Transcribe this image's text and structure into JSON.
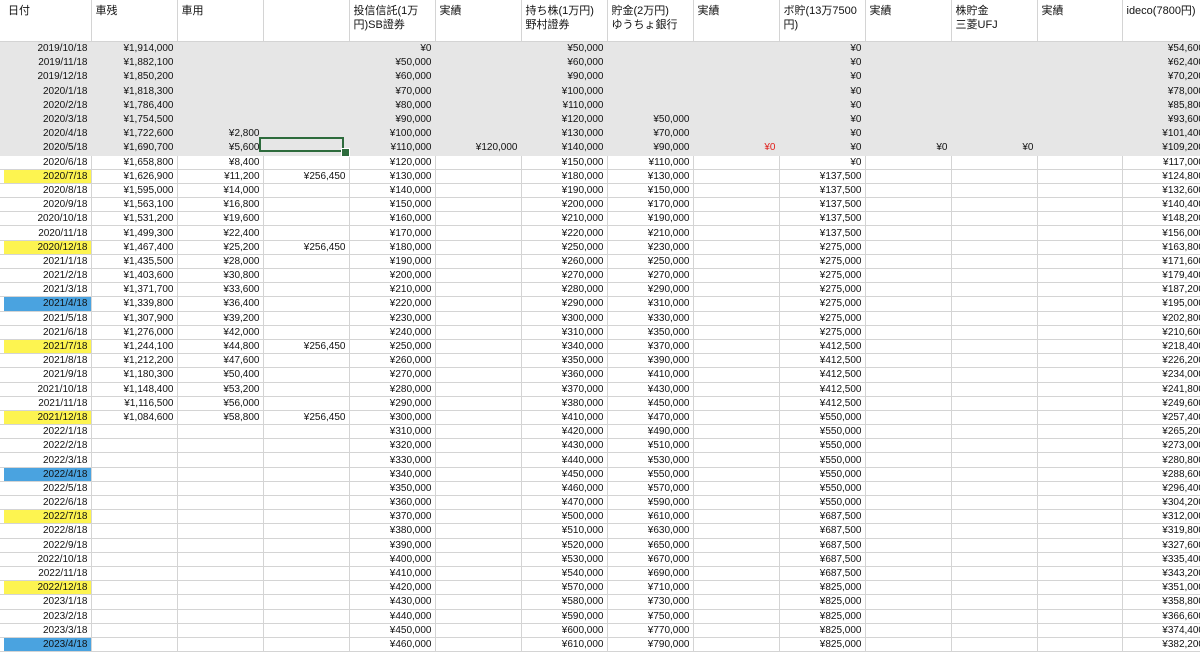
{
  "headers": [
    "日付",
    "車残",
    "車用",
    "",
    "投信信託(1万\n円)SB證券",
    "実績",
    "持ち株(1万円)\n野村證券",
    "貯金(2万円)\nゆうちょ銀行",
    "実績",
    "ボ貯(13万7500\n円)",
    "実績",
    "株貯金\n三菱UFJ",
    "実績",
    "ideco(7800円)"
  ],
  "rows": [
    {
      "date": "2019/10/18",
      "car_balance": "¥1,914,000",
      "car_use": "",
      "col4": "",
      "trust": "¥0",
      "trust_actual": "",
      "stock": "¥50,000",
      "savings": "",
      "savings_actual": "",
      "bonus": "¥0",
      "bonus_actual": "",
      "kabu": "",
      "kabu_actual": "",
      "ideco": "¥54,600",
      "grey": true
    },
    {
      "date": "2019/11/18",
      "car_balance": "¥1,882,100",
      "car_use": "",
      "col4": "",
      "trust": "¥50,000",
      "trust_actual": "",
      "stock": "¥60,000",
      "savings": "",
      "savings_actual": "",
      "bonus": "¥0",
      "bonus_actual": "",
      "kabu": "",
      "kabu_actual": "",
      "ideco": "¥62,400",
      "grey": true
    },
    {
      "date": "2019/12/18",
      "car_balance": "¥1,850,200",
      "car_use": "",
      "col4": "",
      "trust": "¥60,000",
      "trust_actual": "",
      "stock": "¥90,000",
      "savings": "",
      "savings_actual": "",
      "bonus": "¥0",
      "bonus_actual": "",
      "kabu": "",
      "kabu_actual": "",
      "ideco": "¥70,200",
      "grey": true
    },
    {
      "date": "2020/1/18",
      "car_balance": "¥1,818,300",
      "car_use": "",
      "col4": "",
      "trust": "¥70,000",
      "trust_actual": "",
      "stock": "¥100,000",
      "savings": "",
      "savings_actual": "",
      "bonus": "¥0",
      "bonus_actual": "",
      "kabu": "",
      "kabu_actual": "",
      "ideco": "¥78,000",
      "grey": true
    },
    {
      "date": "2020/2/18",
      "car_balance": "¥1,786,400",
      "car_use": "",
      "col4": "",
      "trust": "¥80,000",
      "trust_actual": "",
      "stock": "¥110,000",
      "savings": "",
      "savings_actual": "",
      "bonus": "¥0",
      "bonus_actual": "",
      "kabu": "",
      "kabu_actual": "",
      "ideco": "¥85,800",
      "grey": true
    },
    {
      "date": "2020/3/18",
      "car_balance": "¥1,754,500",
      "car_use": "",
      "col4": "",
      "trust": "¥90,000",
      "trust_actual": "",
      "stock": "¥120,000",
      "savings": "¥50,000",
      "savings_actual": "",
      "bonus": "¥0",
      "bonus_actual": "",
      "kabu": "",
      "kabu_actual": "",
      "ideco": "¥93,600",
      "grey": true
    },
    {
      "date": "2020/4/18",
      "car_balance": "¥1,722,600",
      "car_use": "¥2,800",
      "col4": "",
      "trust": "¥100,000",
      "trust_actual": "",
      "stock": "¥130,000",
      "savings": "¥70,000",
      "savings_actual": "",
      "bonus": "¥0",
      "bonus_actual": "",
      "kabu": "",
      "kabu_actual": "",
      "ideco": "¥101,400",
      "grey": true
    },
    {
      "date": "2020/5/18",
      "car_balance": "¥1,690,700",
      "car_use": "¥5,600",
      "col4": "",
      "trust": "¥110,000",
      "trust_actual": "¥120,000",
      "stock": "¥140,000",
      "savings": "¥90,000",
      "savings_actual": "¥0",
      "bonus": "¥0",
      "bonus_actual": "¥0",
      "kabu": "¥0",
      "kabu_actual": "",
      "ideco": "¥109,200",
      "grey": true
    },
    {
      "date": "2020/6/18",
      "car_balance": "¥1,658,800",
      "car_use": "¥8,400",
      "col4": "",
      "trust": "¥120,000",
      "trust_actual": "",
      "stock": "¥150,000",
      "savings": "¥110,000",
      "savings_actual": "",
      "bonus": "¥0",
      "bonus_actual": "",
      "kabu": "",
      "kabu_actual": "",
      "ideco": "¥117,000"
    },
    {
      "date": "2020/7/18",
      "car_balance": "¥1,626,900",
      "car_use": "¥11,200",
      "col4": "¥256,450",
      "trust": "¥130,000",
      "trust_actual": "",
      "stock": "¥180,000",
      "savings": "¥130,000",
      "savings_actual": "",
      "bonus": "¥137,500",
      "bonus_actual": "",
      "kabu": "",
      "kabu_actual": "",
      "ideco": "¥124,800",
      "hl": "yellow"
    },
    {
      "date": "2020/8/18",
      "car_balance": "¥1,595,000",
      "car_use": "¥14,000",
      "col4": "",
      "trust": "¥140,000",
      "trust_actual": "",
      "stock": "¥190,000",
      "savings": "¥150,000",
      "savings_actual": "",
      "bonus": "¥137,500",
      "bonus_actual": "",
      "kabu": "",
      "kabu_actual": "",
      "ideco": "¥132,600"
    },
    {
      "date": "2020/9/18",
      "car_balance": "¥1,563,100",
      "car_use": "¥16,800",
      "col4": "",
      "trust": "¥150,000",
      "trust_actual": "",
      "stock": "¥200,000",
      "savings": "¥170,000",
      "savings_actual": "",
      "bonus": "¥137,500",
      "bonus_actual": "",
      "kabu": "",
      "kabu_actual": "",
      "ideco": "¥140,400"
    },
    {
      "date": "2020/10/18",
      "car_balance": "¥1,531,200",
      "car_use": "¥19,600",
      "col4": "",
      "trust": "¥160,000",
      "trust_actual": "",
      "stock": "¥210,000",
      "savings": "¥190,000",
      "savings_actual": "",
      "bonus": "¥137,500",
      "bonus_actual": "",
      "kabu": "",
      "kabu_actual": "",
      "ideco": "¥148,200"
    },
    {
      "date": "2020/11/18",
      "car_balance": "¥1,499,300",
      "car_use": "¥22,400",
      "col4": "",
      "trust": "¥170,000",
      "trust_actual": "",
      "stock": "¥220,000",
      "savings": "¥210,000",
      "savings_actual": "",
      "bonus": "¥137,500",
      "bonus_actual": "",
      "kabu": "",
      "kabu_actual": "",
      "ideco": "¥156,000"
    },
    {
      "date": "2020/12/18",
      "car_balance": "¥1,467,400",
      "car_use": "¥25,200",
      "col4": "¥256,450",
      "trust": "¥180,000",
      "trust_actual": "",
      "stock": "¥250,000",
      "savings": "¥230,000",
      "savings_actual": "",
      "bonus": "¥275,000",
      "bonus_actual": "",
      "kabu": "",
      "kabu_actual": "",
      "ideco": "¥163,800",
      "hl": "yellow"
    },
    {
      "date": "2021/1/18",
      "car_balance": "¥1,435,500",
      "car_use": "¥28,000",
      "col4": "",
      "trust": "¥190,000",
      "trust_actual": "",
      "stock": "¥260,000",
      "savings": "¥250,000",
      "savings_actual": "",
      "bonus": "¥275,000",
      "bonus_actual": "",
      "kabu": "",
      "kabu_actual": "",
      "ideco": "¥171,600"
    },
    {
      "date": "2021/2/18",
      "car_balance": "¥1,403,600",
      "car_use": "¥30,800",
      "col4": "",
      "trust": "¥200,000",
      "trust_actual": "",
      "stock": "¥270,000",
      "savings": "¥270,000",
      "savings_actual": "",
      "bonus": "¥275,000",
      "bonus_actual": "",
      "kabu": "",
      "kabu_actual": "",
      "ideco": "¥179,400"
    },
    {
      "date": "2021/3/18",
      "car_balance": "¥1,371,700",
      "car_use": "¥33,600",
      "col4": "",
      "trust": "¥210,000",
      "trust_actual": "",
      "stock": "¥280,000",
      "savings": "¥290,000",
      "savings_actual": "",
      "bonus": "¥275,000",
      "bonus_actual": "",
      "kabu": "",
      "kabu_actual": "",
      "ideco": "¥187,200"
    },
    {
      "date": "2021/4/18",
      "car_balance": "¥1,339,800",
      "car_use": "¥36,400",
      "col4": "",
      "trust": "¥220,000",
      "trust_actual": "",
      "stock": "¥290,000",
      "savings": "¥310,000",
      "savings_actual": "",
      "bonus": "¥275,000",
      "bonus_actual": "",
      "kabu": "",
      "kabu_actual": "",
      "ideco": "¥195,000",
      "hl": "blue"
    },
    {
      "date": "2021/5/18",
      "car_balance": "¥1,307,900",
      "car_use": "¥39,200",
      "col4": "",
      "trust": "¥230,000",
      "trust_actual": "",
      "stock": "¥300,000",
      "savings": "¥330,000",
      "savings_actual": "",
      "bonus": "¥275,000",
      "bonus_actual": "",
      "kabu": "",
      "kabu_actual": "",
      "ideco": "¥202,800"
    },
    {
      "date": "2021/6/18",
      "car_balance": "¥1,276,000",
      "car_use": "¥42,000",
      "col4": "",
      "trust": "¥240,000",
      "trust_actual": "",
      "stock": "¥310,000",
      "savings": "¥350,000",
      "savings_actual": "",
      "bonus": "¥275,000",
      "bonus_actual": "",
      "kabu": "",
      "kabu_actual": "",
      "ideco": "¥210,600"
    },
    {
      "date": "2021/7/18",
      "car_balance": "¥1,244,100",
      "car_use": "¥44,800",
      "col4": "¥256,450",
      "trust": "¥250,000",
      "trust_actual": "",
      "stock": "¥340,000",
      "savings": "¥370,000",
      "savings_actual": "",
      "bonus": "¥412,500",
      "bonus_actual": "",
      "kabu": "",
      "kabu_actual": "",
      "ideco": "¥218,400",
      "hl": "yellow"
    },
    {
      "date": "2021/8/18",
      "car_balance": "¥1,212,200",
      "car_use": "¥47,600",
      "col4": "",
      "trust": "¥260,000",
      "trust_actual": "",
      "stock": "¥350,000",
      "savings": "¥390,000",
      "savings_actual": "",
      "bonus": "¥412,500",
      "bonus_actual": "",
      "kabu": "",
      "kabu_actual": "",
      "ideco": "¥226,200"
    },
    {
      "date": "2021/9/18",
      "car_balance": "¥1,180,300",
      "car_use": "¥50,400",
      "col4": "",
      "trust": "¥270,000",
      "trust_actual": "",
      "stock": "¥360,000",
      "savings": "¥410,000",
      "savings_actual": "",
      "bonus": "¥412,500",
      "bonus_actual": "",
      "kabu": "",
      "kabu_actual": "",
      "ideco": "¥234,000"
    },
    {
      "date": "2021/10/18",
      "car_balance": "¥1,148,400",
      "car_use": "¥53,200",
      "col4": "",
      "trust": "¥280,000",
      "trust_actual": "",
      "stock": "¥370,000",
      "savings": "¥430,000",
      "savings_actual": "",
      "bonus": "¥412,500",
      "bonus_actual": "",
      "kabu": "",
      "kabu_actual": "",
      "ideco": "¥241,800"
    },
    {
      "date": "2021/11/18",
      "car_balance": "¥1,116,500",
      "car_use": "¥56,000",
      "col4": "",
      "trust": "¥290,000",
      "trust_actual": "",
      "stock": "¥380,000",
      "savings": "¥450,000",
      "savings_actual": "",
      "bonus": "¥412,500",
      "bonus_actual": "",
      "kabu": "",
      "kabu_actual": "",
      "ideco": "¥249,600"
    },
    {
      "date": "2021/12/18",
      "car_balance": "¥1,084,600",
      "car_use": "¥58,800",
      "col4": "¥256,450",
      "trust": "¥300,000",
      "trust_actual": "",
      "stock": "¥410,000",
      "savings": "¥470,000",
      "savings_actual": "",
      "bonus": "¥550,000",
      "bonus_actual": "",
      "kabu": "",
      "kabu_actual": "",
      "ideco": "¥257,400",
      "hl": "yellow"
    },
    {
      "date": "2022/1/18",
      "car_balance": "",
      "car_use": "",
      "col4": "",
      "trust": "¥310,000",
      "trust_actual": "",
      "stock": "¥420,000",
      "savings": "¥490,000",
      "savings_actual": "",
      "bonus": "¥550,000",
      "bonus_actual": "",
      "kabu": "",
      "kabu_actual": "",
      "ideco": "¥265,200"
    },
    {
      "date": "2022/2/18",
      "car_balance": "",
      "car_use": "",
      "col4": "",
      "trust": "¥320,000",
      "trust_actual": "",
      "stock": "¥430,000",
      "savings": "¥510,000",
      "savings_actual": "",
      "bonus": "¥550,000",
      "bonus_actual": "",
      "kabu": "",
      "kabu_actual": "",
      "ideco": "¥273,000"
    },
    {
      "date": "2022/3/18",
      "car_balance": "",
      "car_use": "",
      "col4": "",
      "trust": "¥330,000",
      "trust_actual": "",
      "stock": "¥440,000",
      "savings": "¥530,000",
      "savings_actual": "",
      "bonus": "¥550,000",
      "bonus_actual": "",
      "kabu": "",
      "kabu_actual": "",
      "ideco": "¥280,800"
    },
    {
      "date": "2022/4/18",
      "car_balance": "",
      "car_use": "",
      "col4": "",
      "trust": "¥340,000",
      "trust_actual": "",
      "stock": "¥450,000",
      "savings": "¥550,000",
      "savings_actual": "",
      "bonus": "¥550,000",
      "bonus_actual": "",
      "kabu": "",
      "kabu_actual": "",
      "ideco": "¥288,600",
      "hl": "blue"
    },
    {
      "date": "2022/5/18",
      "car_balance": "",
      "car_use": "",
      "col4": "",
      "trust": "¥350,000",
      "trust_actual": "",
      "stock": "¥460,000",
      "savings": "¥570,000",
      "savings_actual": "",
      "bonus": "¥550,000",
      "bonus_actual": "",
      "kabu": "",
      "kabu_actual": "",
      "ideco": "¥296,400"
    },
    {
      "date": "2022/6/18",
      "car_balance": "",
      "car_use": "",
      "col4": "",
      "trust": "¥360,000",
      "trust_actual": "",
      "stock": "¥470,000",
      "savings": "¥590,000",
      "savings_actual": "",
      "bonus": "¥550,000",
      "bonus_actual": "",
      "kabu": "",
      "kabu_actual": "",
      "ideco": "¥304,200"
    },
    {
      "date": "2022/7/18",
      "car_balance": "",
      "car_use": "",
      "col4": "",
      "trust": "¥370,000",
      "trust_actual": "",
      "stock": "¥500,000",
      "savings": "¥610,000",
      "savings_actual": "",
      "bonus": "¥687,500",
      "bonus_actual": "",
      "kabu": "",
      "kabu_actual": "",
      "ideco": "¥312,000",
      "hl": "yellow"
    },
    {
      "date": "2022/8/18",
      "car_balance": "",
      "car_use": "",
      "col4": "",
      "trust": "¥380,000",
      "trust_actual": "",
      "stock": "¥510,000",
      "savings": "¥630,000",
      "savings_actual": "",
      "bonus": "¥687,500",
      "bonus_actual": "",
      "kabu": "",
      "kabu_actual": "",
      "ideco": "¥319,800"
    },
    {
      "date": "2022/9/18",
      "car_balance": "",
      "car_use": "",
      "col4": "",
      "trust": "¥390,000",
      "trust_actual": "",
      "stock": "¥520,000",
      "savings": "¥650,000",
      "savings_actual": "",
      "bonus": "¥687,500",
      "bonus_actual": "",
      "kabu": "",
      "kabu_actual": "",
      "ideco": "¥327,600"
    },
    {
      "date": "2022/10/18",
      "car_balance": "",
      "car_use": "",
      "col4": "",
      "trust": "¥400,000",
      "trust_actual": "",
      "stock": "¥530,000",
      "savings": "¥670,000",
      "savings_actual": "",
      "bonus": "¥687,500",
      "bonus_actual": "",
      "kabu": "",
      "kabu_actual": "",
      "ideco": "¥335,400"
    },
    {
      "date": "2022/11/18",
      "car_balance": "",
      "car_use": "",
      "col4": "",
      "trust": "¥410,000",
      "trust_actual": "",
      "stock": "¥540,000",
      "savings": "¥690,000",
      "savings_actual": "",
      "bonus": "¥687,500",
      "bonus_actual": "",
      "kabu": "",
      "kabu_actual": "",
      "ideco": "¥343,200"
    },
    {
      "date": "2022/12/18",
      "car_balance": "",
      "car_use": "",
      "col4": "",
      "trust": "¥420,000",
      "trust_actual": "",
      "stock": "¥570,000",
      "savings": "¥710,000",
      "savings_actual": "",
      "bonus": "¥825,000",
      "bonus_actual": "",
      "kabu": "",
      "kabu_actual": "",
      "ideco": "¥351,000",
      "hl": "yellow"
    },
    {
      "date": "2023/1/18",
      "car_balance": "",
      "car_use": "",
      "col4": "",
      "trust": "¥430,000",
      "trust_actual": "",
      "stock": "¥580,000",
      "savings": "¥730,000",
      "savings_actual": "",
      "bonus": "¥825,000",
      "bonus_actual": "",
      "kabu": "",
      "kabu_actual": "",
      "ideco": "¥358,800"
    },
    {
      "date": "2023/2/18",
      "car_balance": "",
      "car_use": "",
      "col4": "",
      "trust": "¥440,000",
      "trust_actual": "",
      "stock": "¥590,000",
      "savings": "¥750,000",
      "savings_actual": "",
      "bonus": "¥825,000",
      "bonus_actual": "",
      "kabu": "",
      "kabu_actual": "",
      "ideco": "¥366,600"
    },
    {
      "date": "2023/3/18",
      "car_balance": "",
      "car_use": "",
      "col4": "",
      "trust": "¥450,000",
      "trust_actual": "",
      "stock": "¥600,000",
      "savings": "¥770,000",
      "savings_actual": "",
      "bonus": "¥825,000",
      "bonus_actual": "",
      "kabu": "",
      "kabu_actual": "",
      "ideco": "¥374,400"
    },
    {
      "date": "2023/4/18",
      "car_balance": "",
      "car_use": "",
      "col4": "",
      "trust": "¥460,000",
      "trust_actual": "",
      "stock": "¥610,000",
      "savings": "¥790,000",
      "savings_actual": "",
      "bonus": "¥825,000",
      "bonus_actual": "",
      "kabu": "",
      "kabu_actual": "",
      "ideco": "¥382,200",
      "hl": "blue"
    }
  ],
  "colors": {
    "grey_band": "#e6e6e6",
    "highlight_yellow": "#fdf450",
    "highlight_blue": "#4aa3e0",
    "negative_red": "#e0201c",
    "selection_green": "#2d6b3c"
  }
}
